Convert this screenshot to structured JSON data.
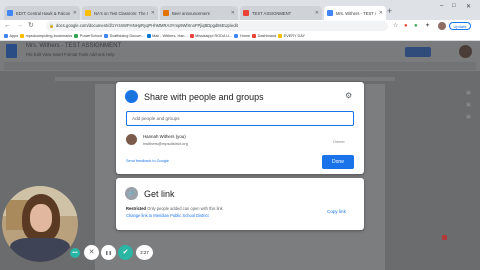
{
  "browser": {
    "tabs": [
      {
        "title": "EDIT: Central Hawk & Falcon",
        "active": false,
        "favicon_color": "#4285f4"
      },
      {
        "title": "NA's on Test Classrom: The Sci",
        "active": false,
        "favicon_color": "#fbbc04"
      },
      {
        "title": "Beer announcement",
        "active": false,
        "favicon_color": "#e37400"
      },
      {
        "title": "TEST ASSIGNMENT",
        "active": false,
        "favicon_color": "#ea4335"
      },
      {
        "title": "Mrs. Withers - TEST ASSIGNMENT",
        "active": true,
        "favicon_color": "#4285f4"
      }
    ],
    "new_tab_label": "+",
    "window_controls": [
      "–",
      "□",
      "✕"
    ],
    "url": "docs.google.com/document/d/1Yr4nWFHNHpRyqPHhMMRA3Ymp9WlXnoFPjiqBDpgd8sEUp/edit",
    "update_label": "Update",
    "bookmarks": [
      {
        "label": "Apps",
        "color": "#4285f4"
      },
      {
        "label": "mpsdcomputing-bookmarks",
        "color": "#fbbc04"
      },
      {
        "label": "PowerSchool",
        "color": "#34a853"
      },
      {
        "label": "Scaffolding Docum...",
        "color": "#4285f4"
      },
      {
        "label": "Mail - Withers, Han...",
        "color": "#0078d4"
      },
      {
        "label": "Mississippi RODA Li...",
        "color": "#ea4335"
      },
      {
        "label": "Home",
        "color": "#4285f4"
      },
      {
        "label": "Dashboard",
        "color": "#ea4335"
      },
      {
        "label": "EVERY DAY",
        "color": "#fbbc04"
      }
    ]
  },
  "docs": {
    "title": "Mrs. Withers - TEST ASSIGNMENT",
    "menus": "File  Edit  View  Insert  Format  Tools  Add-ons  Help"
  },
  "share_dialog": {
    "title": "Share with people and groups",
    "input_placeholder": "Add people and groups",
    "person": {
      "name": "Hannah Withers (you)",
      "email": "hwithers@mpsdistrict.org",
      "role": "Owner"
    },
    "feedback_link": "Send feedback to Google",
    "done_label": "Done",
    "icon_color": "#1a73e8"
  },
  "get_link": {
    "title": "Get link",
    "restricted_label": "Restricted",
    "description": "Only people added can open with this link",
    "change_link": "Change link to Meridian Public School District",
    "copy_link": "Copy link",
    "icon_color": "#9aa0a6"
  },
  "recorder": {
    "timer": "2:27",
    "controls": [
      {
        "name": "delete",
        "glyph": "✕",
        "bg": "#ffffff",
        "fg": "#5f6368"
      },
      {
        "name": "pause",
        "glyph": "❚❚",
        "bg": "#ffffff",
        "fg": "#5f6368"
      },
      {
        "name": "stop",
        "glyph": "✔",
        "bg": "#2bb5a4",
        "fg": "#ffffff"
      }
    ],
    "menu_color": "#2bb5a4"
  }
}
